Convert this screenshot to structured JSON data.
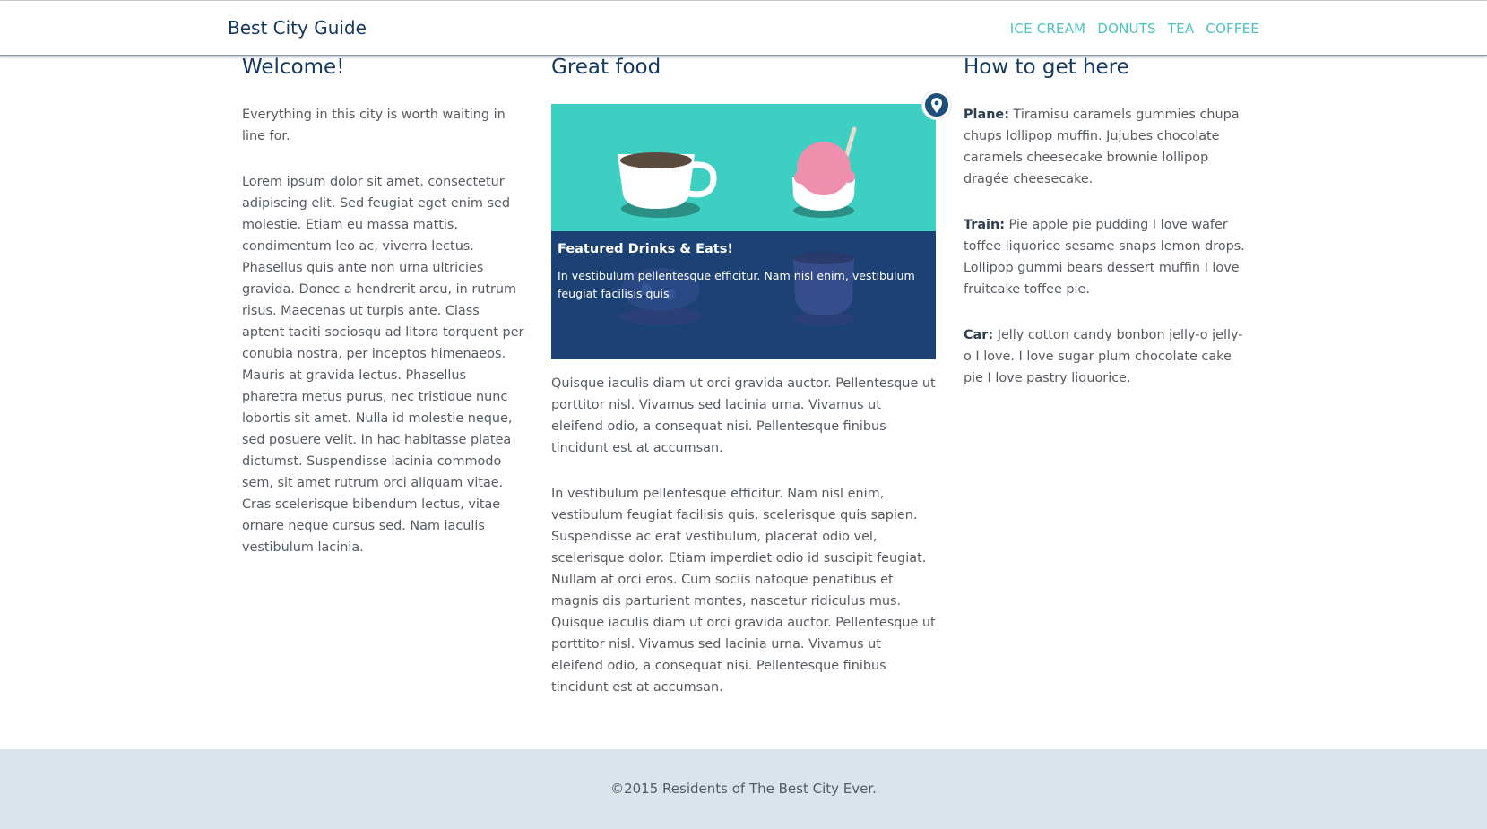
{
  "header": {
    "brand": "Best City Guide",
    "nav": [
      "ICE CREAM",
      "DONUTS",
      "TEA",
      "COFFEE"
    ]
  },
  "welcome": {
    "title": "Welcome!",
    "intro": "Everything in this city is worth waiting in line for.",
    "body": "Lorem ipsum dolor sit amet, consectetur adipiscing elit. Sed feugiat eget enim sed molestie. Etiam eu massa mattis, condimentum leo ac, viverra lectus. Phasellus quis ante non urna ultricies gravida. Donec a hendrerit arcu, in rutrum risus. Maecenas ut turpis ante. Class aptent taciti sociosqu ad litora torquent per conubia nostra, per inceptos himenaeos. Mauris at gravida lectus. Phasellus pharetra metus purus, nec tristique nunc lobortis sit amet. Nulla id molestie neque, sed posuere velit. In hac habitasse platea dictumst. Suspendisse lacinia commodo sem, sit amet rutrum orci aliquam vitae. Cras scelerisque bibendum lectus, vitae ornare neque cursus sed. Nam iaculis vestibulum lacinia."
  },
  "food": {
    "title": "Great food",
    "card": {
      "title": "Featured Drinks & Eats!",
      "description": "In vestibulum pellentesque efficitur. Nam nisl enim, vestibulum feugiat facilisis quis"
    },
    "p1": "Quisque iaculis diam ut orci gravida auctor. Pellentesque ut porttitor nisl. Vivamus sed lacinia urna. Vivamus ut eleifend odio, a consequat nisi. Pellentesque finibus tincidunt est at accumsan.",
    "p2": "In vestibulum pellentesque efficitur. Nam nisl enim, vestibulum feugiat facilisis quis, scelerisque quis sapien. Suspendisse ac erat vestibulum, placerat odio vel, scelerisque dolor. Etiam imperdiet odio id suscipit feugiat. Nullam at orci eros. Cum sociis natoque penatibus et magnis dis parturient montes, nascetur ridiculus mus. Quisque iaculis diam ut orci gravida auctor. Pellentesque ut porttitor nisl. Vivamus sed lacinia urna. Vivamus ut eleifend odio, a consequat nisi. Pellentesque finibus tincidunt est at accumsan."
  },
  "directions": {
    "title": "How to get here",
    "plane_label": "Plane:",
    "plane": " Tiramisu caramels gummies chupa chups lollipop muffin. Jujubes chocolate caramels cheesecake brownie lollipop dragée cheesecake.",
    "train_label": "Train:",
    "train": " Pie apple pie pudding I love wafer toffee liquorice sesame snaps lemon drops. Lollipop gummi bears dessert muffin I love fruitcake toffee pie.",
    "car_label": "Car:",
    "car": " Jelly cotton candy bonbon jelly-o jelly-o I love. I love sugar plum chocolate cake pie I love pastry liquorice."
  },
  "footer": {
    "text": "©2015 Residents of The Best City Ever."
  },
  "colors": {
    "brand": "#15395e",
    "nav": "#4cc3c0",
    "card_top": "#3ccfc2",
    "card_bottom": "#1c4275",
    "footer_bg": "#d9e4ec"
  },
  "icons": [
    "location-pin-icon"
  ]
}
